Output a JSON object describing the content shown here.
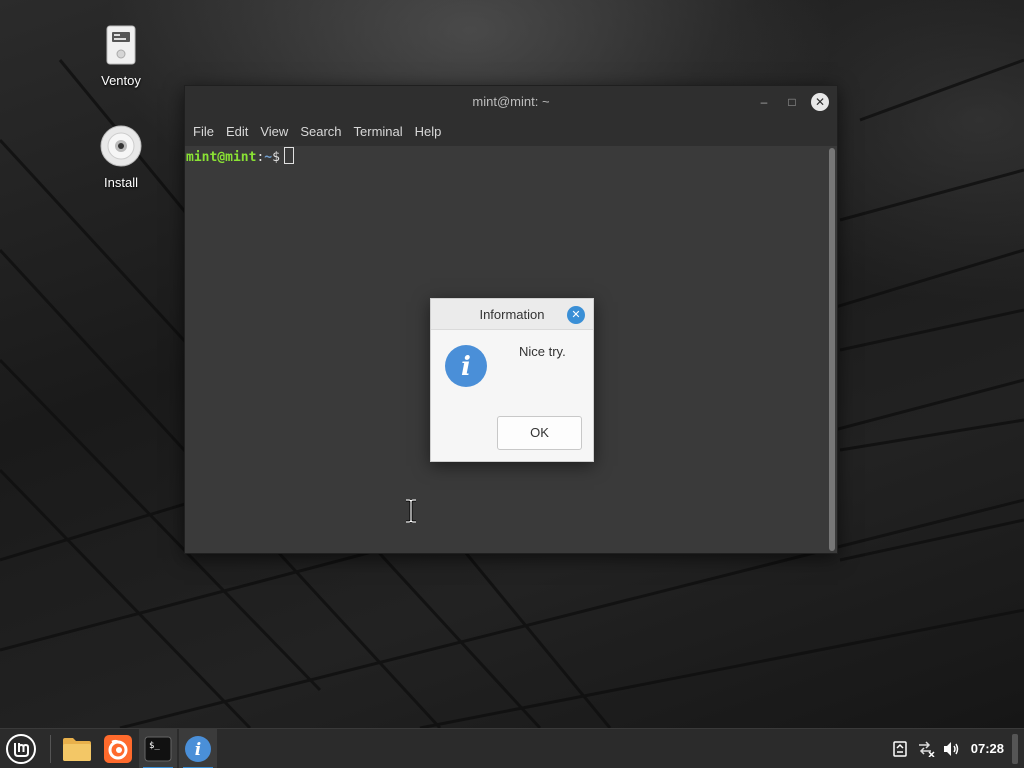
{
  "desktop": {
    "icons": [
      {
        "label": "Ventoy",
        "icon": "usb-drive-icon"
      },
      {
        "label": "Install",
        "icon": "disc-icon"
      }
    ]
  },
  "terminal": {
    "title": "mint@mint: ~",
    "menu": [
      "File",
      "Edit",
      "View",
      "Search",
      "Terminal",
      "Help"
    ],
    "prompt_user": "mint@mint",
    "prompt_sep": ":",
    "prompt_path": "~",
    "prompt_symbol": "$",
    "minimize_glyph": "–",
    "maximize_glyph": "□",
    "close_glyph": "✕"
  },
  "dialog": {
    "title": "Information",
    "message": "Nice try.",
    "ok_label": "OK",
    "close_glyph": "✕",
    "icon_glyph": "i"
  },
  "taskbar": {
    "apps": [
      "menu-icon",
      "files-icon",
      "firefox-icon",
      "terminal-icon",
      "info-icon"
    ],
    "terminal_glyph": "$_",
    "clock": "07:28"
  },
  "colors": {
    "accent": "#3a8fd6",
    "prompt_user": "#8ae234",
    "prompt_path": "#729fcf"
  }
}
